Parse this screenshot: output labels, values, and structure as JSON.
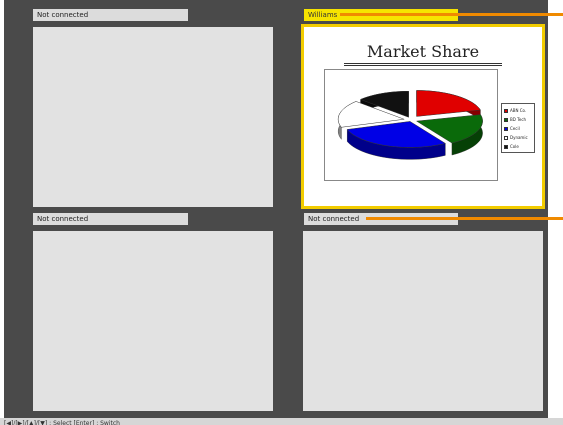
{
  "panels": [
    {
      "label": "Not connected",
      "state": "disconnected"
    },
    {
      "label": "Williams",
      "state": "connected",
      "selected": true
    },
    {
      "label": "Not connected",
      "state": "disconnected"
    },
    {
      "label": "Not connected",
      "state": "disconnected"
    }
  ],
  "slide": {
    "title": "Market Share"
  },
  "chart_data": {
    "type": "pie",
    "title": "",
    "categories": [
      "ABN Co.",
      "BD Tech",
      "Cecil",
      "Dynamic",
      "Cole"
    ],
    "values": [
      21,
      20,
      29,
      17,
      13
    ],
    "colors": [
      "#e00000",
      "#0a6a0a",
      "#0000e6",
      "#ffffff",
      "#111111"
    ],
    "legend": "right"
  },
  "footer": {
    "hint": "[◀]/[▶]/[▲]/[▼] : Select  [Enter] : Switch"
  },
  "colors": {
    "background": "#4a4a4a",
    "panel": "#e2e2e2",
    "active_label": "#f6e400",
    "selection_border": "#f2cc00",
    "indicator": "#f08a00"
  }
}
